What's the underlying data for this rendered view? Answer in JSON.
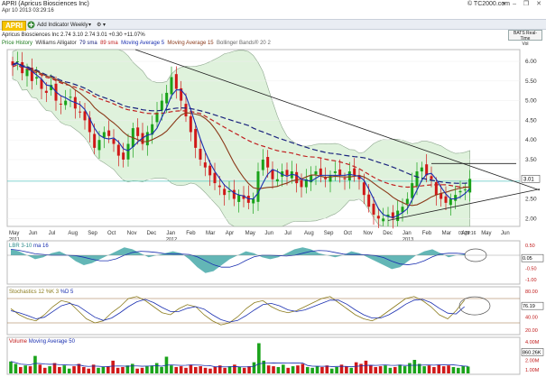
{
  "window": {
    "title": "APRI (Apricus Biosciences Inc)",
    "subtitle": "Apr 10 2013 03:29:16",
    "site": "© TC2000.com",
    "controls": "▾ – ❐ ✕"
  },
  "toolbar": {
    "symbol": "APRI",
    "add_indicator": "Add Indicator",
    "timeframe": "Weekly",
    "quote": "Apricus Biosciences Inc  2.74  3.10  2.74  3.01  +0.30  +11.07%",
    "realtime": "BATS Real-Time"
  },
  "legend": {
    "price_history": "Price History",
    "alligator": "Williams Alligator",
    "sma79": "79 sma",
    "sma89": "89 sma",
    "ma5": "Moving Average 5",
    "ma15": "Moving Average 15",
    "bb": "Bollinger Bands® 20 2"
  },
  "colors": {
    "up": "#1aa31a",
    "down": "#d01818",
    "ma_blue": "#1a2fb0",
    "ma_brown": "#8b3a1a",
    "sma_red": "#c02020",
    "sma_navy": "#1a237e",
    "bb_fill": "#dff2dc",
    "bb_line": "#8fa88f",
    "baseline": "#5cc7c2"
  },
  "price_axis": {
    "ticks": [
      "6.00",
      "5.50",
      "5.00",
      "4.50",
      "4.00",
      "3.50",
      "3.00",
      "2.50",
      "2.00"
    ],
    "last": "3.01"
  },
  "time_axis": {
    "months": [
      "May",
      "Jun",
      "Jul",
      "Aug",
      "Sep",
      "Oct",
      "Nov",
      "Dec",
      "Jan",
      "Feb",
      "Mar",
      "Apr",
      "May",
      "Jun",
      "Jul",
      "Aug",
      "Sep",
      "Oct",
      "Nov",
      "Dec",
      "Jan",
      "Feb",
      "Mar",
      "Apr",
      "May",
      "Jun"
    ],
    "years": [
      "2011",
      "2012",
      "2013"
    ],
    "stamp": "03:29:16"
  },
  "lbr": {
    "label": "LBR 3-10",
    "ma": "ma 16",
    "ticks": [
      "0.50",
      "0.00",
      "-0.50",
      "-1.00"
    ],
    "last": "0.05"
  },
  "stoch": {
    "label": "Stochastics 12 %K 3",
    "d": "%D 5",
    "ticks": [
      "80.00",
      "60.00",
      "40.00",
      "20.00"
    ],
    "last": "76.19"
  },
  "volume": {
    "label": "Volume",
    "ma": "Moving Average 50",
    "ticks": [
      "4.00M",
      "3.00M",
      "2.00M",
      "1.00M"
    ],
    "last": "860.26K"
  },
  "chart_data": {
    "type": "candlestick",
    "ylim": [
      1.8,
      6.3
    ],
    "weeks": 101,
    "closes": [
      5.9,
      6.0,
      5.7,
      5.8,
      5.5,
      5.6,
      5.3,
      5.2,
      5.4,
      5.0,
      4.9,
      5.0,
      5.1,
      4.8,
      4.7,
      4.5,
      4.2,
      3.8,
      4.0,
      4.2,
      4.1,
      3.9,
      3.6,
      3.5,
      3.9,
      4.3,
      4.1,
      3.9,
      4.2,
      4.4,
      4.7,
      5.0,
      5.2,
      5.6,
      5.3,
      5.0,
      4.6,
      4.2,
      3.8,
      3.5,
      3.3,
      3.1,
      2.9,
      2.8,
      2.6,
      2.7,
      2.5,
      2.6,
      2.5,
      2.4,
      2.5,
      3.2,
      3.5,
      3.3,
      3.0,
      3.0,
      3.2,
      3.1,
      3.2,
      2.9,
      2.8,
      3.0,
      3.1,
      3.2,
      3.1,
      3.0,
      3.1,
      3.2,
      3.1,
      3.0,
      3.2,
      3.1,
      3.0,
      2.6,
      2.3,
      2.1,
      2.0,
      2.0,
      2.1,
      2.0,
      2.2,
      2.3,
      2.5,
      2.9,
      3.2,
      3.3,
      3.1,
      3.0,
      2.6,
      2.5,
      2.4,
      2.5,
      2.6,
      2.7,
      2.74,
      3.01
    ]
  },
  "lbr_data": [
    0.3,
    0.2,
    0.0,
    -0.2,
    -0.1,
    0.1,
    0.2,
    0.0,
    -0.3,
    -0.5,
    -0.4,
    -0.2,
    0.0,
    0.2,
    0.4,
    0.3,
    0.1,
    -0.1,
    0.0,
    0.1,
    0.2,
    0.1,
    -0.2,
    -0.6,
    -0.9,
    -0.8,
    -0.5,
    -0.2,
    0.0,
    0.2,
    0.1,
    -0.1,
    -0.2,
    -0.1,
    0.1,
    0.3,
    0.4,
    0.3,
    0.1,
    0.0,
    -0.1,
    0.0,
    0.2,
    0.1,
    -0.1,
    -0.3,
    -0.5,
    -0.7,
    -0.6,
    -0.3,
    0.0,
    0.2,
    0.3,
    0.1,
    -0.1,
    0.0,
    0.05
  ],
  "stoch_k": [
    55,
    40,
    30,
    25,
    40,
    60,
    75,
    70,
    50,
    30,
    20,
    25,
    45,
    60,
    80,
    85,
    75,
    60,
    45,
    40,
    55,
    65,
    60,
    40,
    25,
    15,
    20,
    35,
    55,
    70,
    75,
    60,
    50,
    45,
    50,
    60,
    70,
    80,
    85,
    70,
    55,
    40,
    30,
    25,
    35,
    50,
    65,
    80,
    85,
    75,
    60,
    40,
    30,
    50,
    76
  ],
  "stoch_d": [
    50,
    45,
    38,
    30,
    34,
    48,
    62,
    68,
    62,
    48,
    34,
    26,
    32,
    45,
    60,
    72,
    78,
    70,
    58,
    48,
    48,
    56,
    60,
    54,
    40,
    28,
    22,
    26,
    38,
    52,
    65,
    68,
    62,
    52,
    48,
    52,
    60,
    68,
    76,
    76,
    66,
    52,
    40,
    32,
    32,
    40,
    52,
    66,
    76,
    78,
    70,
    56,
    44,
    42,
    60
  ],
  "vol_data": [
    1.5,
    1.2,
    0.8,
    1.0,
    0.9,
    2.2,
    1.1,
    0.7,
    0.9,
    1.3,
    0.8,
    1.0,
    0.6,
    0.9,
    1.2,
    0.8,
    0.6,
    1.1,
    0.7,
    0.8,
    0.9,
    1.6,
    0.7,
    0.8,
    1.0,
    1.2,
    0.6,
    0.7,
    0.9,
    1.0,
    1.3,
    0.8,
    2.1,
    1.0,
    0.8,
    0.9,
    0.7,
    1.1,
    0.8,
    0.9,
    0.7,
    0.6,
    0.8,
    1.0,
    0.7,
    0.9,
    1.1,
    0.8,
    0.7,
    0.9,
    1.4,
    3.8,
    1.6,
    1.0,
    0.9,
    0.8,
    1.1,
    0.7,
    0.9,
    1.0,
    1.2,
    0.8,
    0.7,
    0.9,
    0.8,
    1.0,
    0.6,
    0.8,
    1.1,
    0.9,
    0.7,
    1.4,
    1.2,
    1.6,
    1.0,
    0.8,
    0.9,
    1.0,
    0.7,
    0.8,
    1.1,
    0.9,
    1.3,
    1.7,
    1.2,
    0.9,
    1.0,
    0.8,
    1.1,
    0.9,
    1.0,
    0.8,
    0.7,
    0.9,
    0.86
  ]
}
